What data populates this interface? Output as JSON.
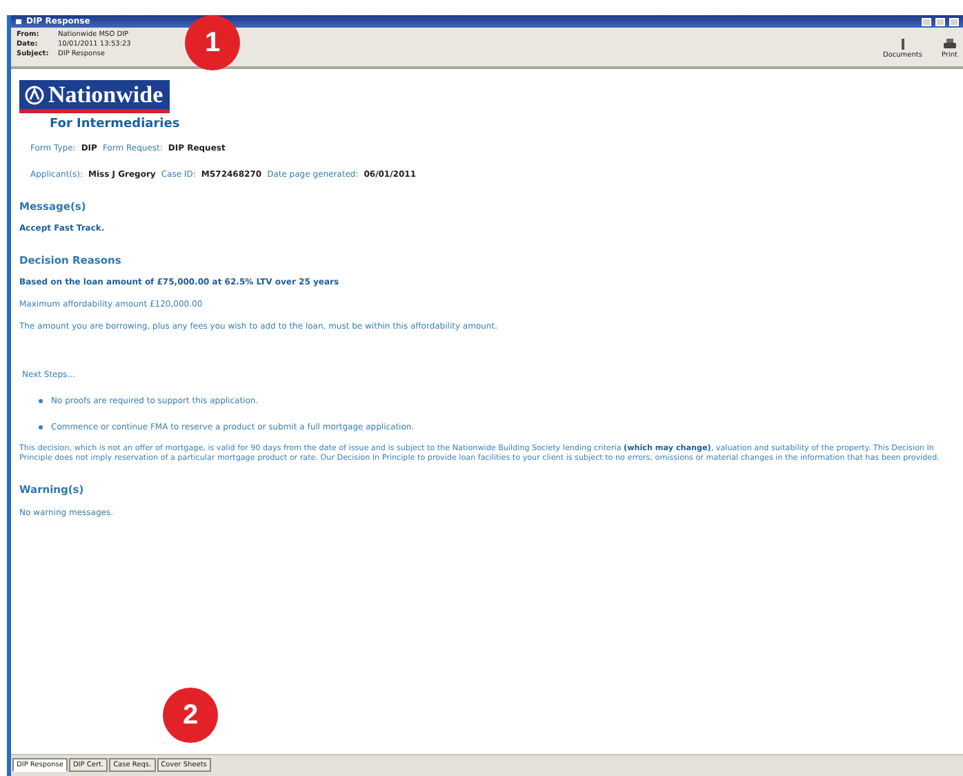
{
  "window": {
    "title": "DIP Response"
  },
  "header": {
    "fields": [
      {
        "label": "From:",
        "value": "Nationwide MSO DIP"
      },
      {
        "label": "Date:",
        "value": "10/01/2011 13:53:23"
      },
      {
        "label": "Subject:",
        "value": "DIP Response"
      }
    ],
    "toolbar": [
      {
        "label": "Documents",
        "kind": "documents"
      },
      {
        "label": "Print",
        "kind": "print"
      }
    ]
  },
  "logo": {
    "name": "Nationwide",
    "tagline": "For Intermediaries"
  },
  "info_lines": [
    [
      {
        "label": "Form Type:",
        "value": "DIP"
      },
      {
        "label": "Form Request:",
        "value": "DIP Request"
      }
    ],
    [
      {
        "label": "Applicant(s):",
        "value": "Miss J Gregory"
      },
      {
        "label": "Case ID:",
        "value": "MS72468270"
      },
      {
        "label": "Date page generated:",
        "value": "06/01/2011"
      }
    ]
  ],
  "blocks": [
    {
      "kind": "heading",
      "text": "Message(s)"
    },
    {
      "kind": "bold",
      "text": "Accept Fast Track."
    },
    {
      "kind": "heading",
      "text": "Decision Reasons"
    },
    {
      "kind": "bold",
      "text": "Based on the loan amount of £75,000.00 at 62.5% LTV over 25 years"
    },
    {
      "kind": "text",
      "text": "Maximum affordability amount £120,000.00"
    },
    {
      "kind": "text",
      "text": "The amount you are borrowing, plus any fees you wish to add to the loan, must be within this affordability amount."
    },
    {
      "kind": "subheading",
      "text": "Next Steps..."
    },
    {
      "kind": "bullet",
      "text": "No proofs are required to support this application."
    },
    {
      "kind": "bullet",
      "text": "Commence or continue FMA to reserve a product or submit a full mortgage application."
    },
    {
      "kind": "para",
      "text": "This decision, which is not an offer of mortgage, is valid for 90 days from the date of issue and is subject to the Nationwide Building Society lending criteria **(which may change)**, valuation and suitability of the property. This Decision In Principle does not imply reservation of a particular mortgage product or rate. Our Decision In Principle to provide loan facilities to your client is subject to no errors, omissions or material changes in the information that has been provided."
    },
    {
      "kind": "heading",
      "text": "Warning(s)"
    },
    {
      "kind": "text",
      "text": "No warning messages."
    }
  ],
  "tabs": [
    {
      "label": "DIP Response",
      "selected": true
    },
    {
      "label": "DIP Cert.",
      "selected": false
    },
    {
      "label": "Case Reqs.",
      "selected": false
    },
    {
      "label": "Cover Sheets",
      "selected": false
    }
  ],
  "callouts": [
    {
      "number": "1"
    },
    {
      "number": "2"
    }
  ]
}
